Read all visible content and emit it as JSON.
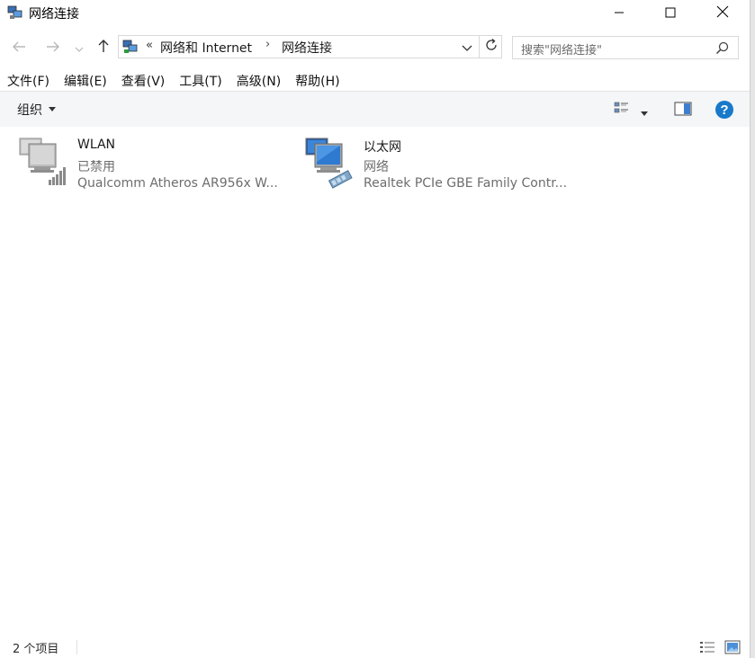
{
  "window": {
    "title": "网络连接",
    "minimize_icon": "minimize-icon",
    "maximize_icon": "maximize-icon",
    "close_icon": "close-icon"
  },
  "nav": {
    "back_icon": "arrow-left-icon",
    "forward_icon": "arrow-right-icon",
    "recent_icon": "chevron-down-icon",
    "up_icon": "arrow-up-icon"
  },
  "address": {
    "overflow": "«",
    "crumbs": [
      "网络和 Internet",
      "网络连接"
    ],
    "separator": "›",
    "refresh_icon": "refresh-icon"
  },
  "search": {
    "placeholder": "搜索\"网络连接\""
  },
  "menu": [
    "文件(F)",
    "编辑(E)",
    "查看(V)",
    "工具(T)",
    "高级(N)",
    "帮助(H)"
  ],
  "toolbar": {
    "organize": "组织",
    "help_icon": "help-icon",
    "help_glyph": "?"
  },
  "connections": [
    {
      "name": "WLAN",
      "status": "已禁用",
      "device": "Qualcomm Atheros AR956x W..."
    },
    {
      "name": "以太网",
      "status": "网络",
      "device": "Realtek PCIe GBE Family Contr..."
    }
  ],
  "statusbar": {
    "count": "2 个项目"
  },
  "colors": {
    "accent": "#1979ca",
    "muted_text": "#6d6d6d",
    "cmdbar_bg": "#f5f6f7"
  }
}
